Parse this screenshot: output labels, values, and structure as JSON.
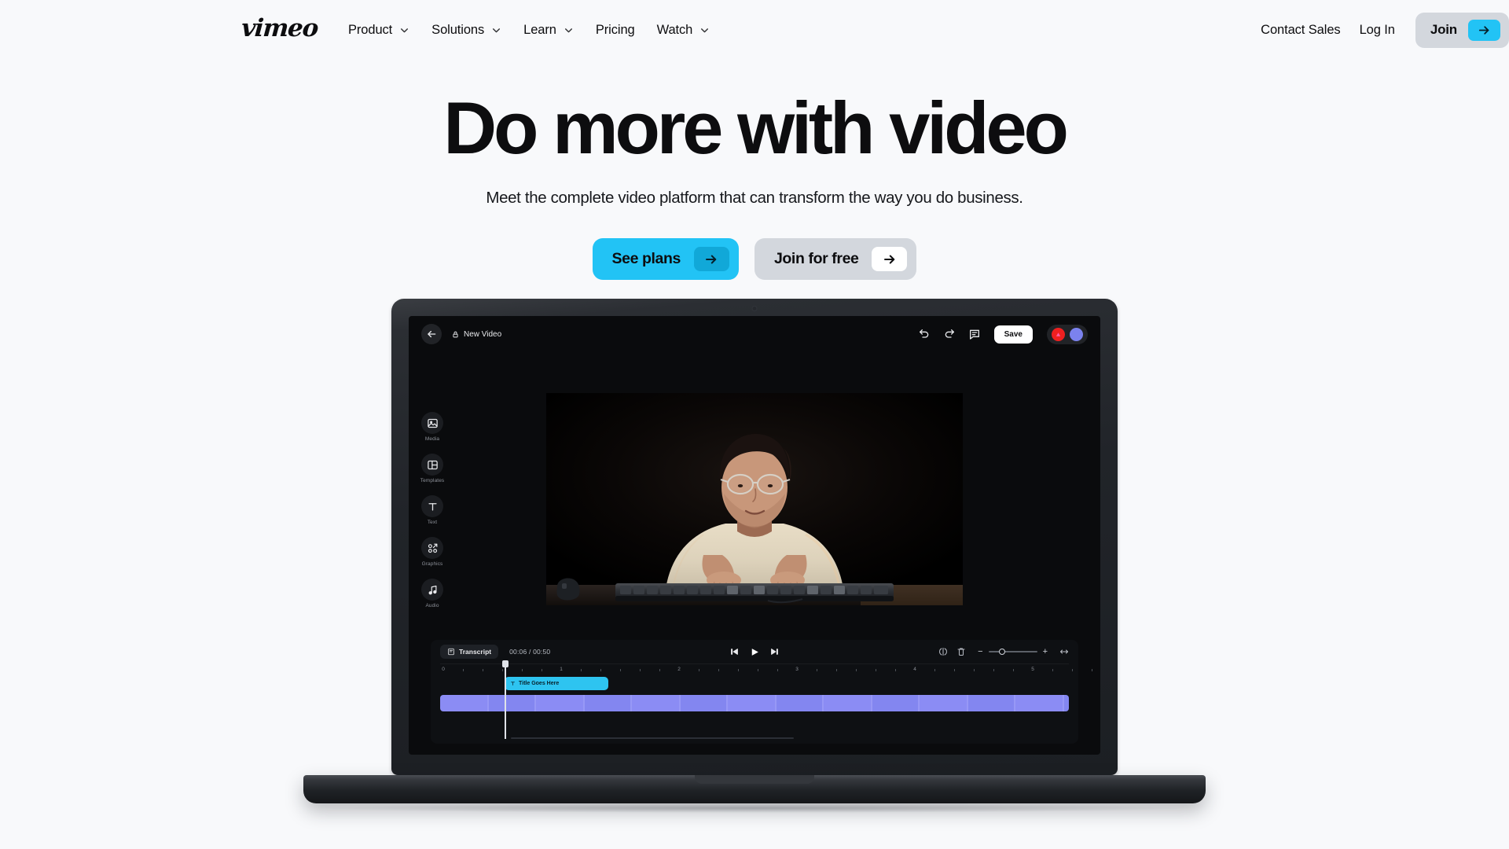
{
  "nav": {
    "logo": "vimeo",
    "items": [
      {
        "label": "Product",
        "has_chevron": true,
        "icon": "chevron-down-icon"
      },
      {
        "label": "Solutions",
        "has_chevron": true,
        "icon": "chevron-down-icon"
      },
      {
        "label": "Learn",
        "has_chevron": true,
        "icon": "chevron-down-icon"
      },
      {
        "label": "Pricing",
        "has_chevron": false,
        "icon": ""
      },
      {
        "label": "Watch",
        "has_chevron": true,
        "icon": "chevron-down-icon"
      }
    ],
    "contact_sales": "Contact Sales",
    "log_in": "Log In",
    "join": "Join",
    "join_arrow_icon": "arrow-right-icon"
  },
  "hero": {
    "headline": "Do more with video",
    "subhead": "Meet the complete video platform that can transform the way you do business.",
    "cta_primary": "See plans",
    "cta_secondary": "Join for free",
    "cta_arrow_icon": "arrow-right-icon"
  },
  "editor": {
    "back_icon": "arrow-left-icon",
    "lock_icon": "lock-icon",
    "title": "New Video",
    "undo_icon": "undo-icon",
    "redo_icon": "redo-icon",
    "comment_icon": "comment-bubble-icon",
    "save_label": "Save",
    "avatars": [
      {
        "name": "avatar-red",
        "color": "#ef2020"
      },
      {
        "name": "avatar-purple",
        "color": "#7b82ee"
      }
    ],
    "rail": [
      {
        "label": "Media",
        "icon": "image-icon"
      },
      {
        "label": "Templates",
        "icon": "layout-icon"
      },
      {
        "label": "Text",
        "icon": "text-icon"
      },
      {
        "label": "Graphics",
        "icon": "graphics-icon"
      },
      {
        "label": "Audio",
        "icon": "music-note-icon"
      }
    ],
    "preview": {
      "description": "Person in cream t-shirt and glasses typing on a mechanical keyboard against a dark background"
    },
    "timeline": {
      "transcript_label": "Transcript",
      "transcript_icon": "transcript-icon",
      "timecode": "00:06 / 00:50",
      "current_time": "00:06",
      "total_time": "00:50",
      "skip_back_icon": "skip-back-icon",
      "play_icon": "play-icon",
      "skip_forward_icon": "skip-forward-icon",
      "split_icon": "split-icon",
      "delete_icon": "trash-icon",
      "zoom_out_label": "−",
      "zoom_in_label": "+",
      "fit_icon": "fit-width-icon",
      "ruler_marks": [
        "0",
        "1",
        "2",
        "3",
        "4",
        "5"
      ],
      "clips": [
        {
          "name": "text-clip",
          "label": "Title Goes Here",
          "icon": "text-icon",
          "color": "#2ec4f0"
        },
        {
          "name": "video-clip",
          "label": "",
          "color": "#8b8cf4"
        }
      ]
    }
  },
  "colors": {
    "page_bg": "#f8f9fb",
    "accent_cyan": "#22c3f5",
    "accent_cyan_dark": "#11a8d8",
    "neutral_chip": "#d3d7dd",
    "ink": "#0d0d0f",
    "editor_bg": "#0a0b0d",
    "timeline_bg": "#0e1013"
  }
}
